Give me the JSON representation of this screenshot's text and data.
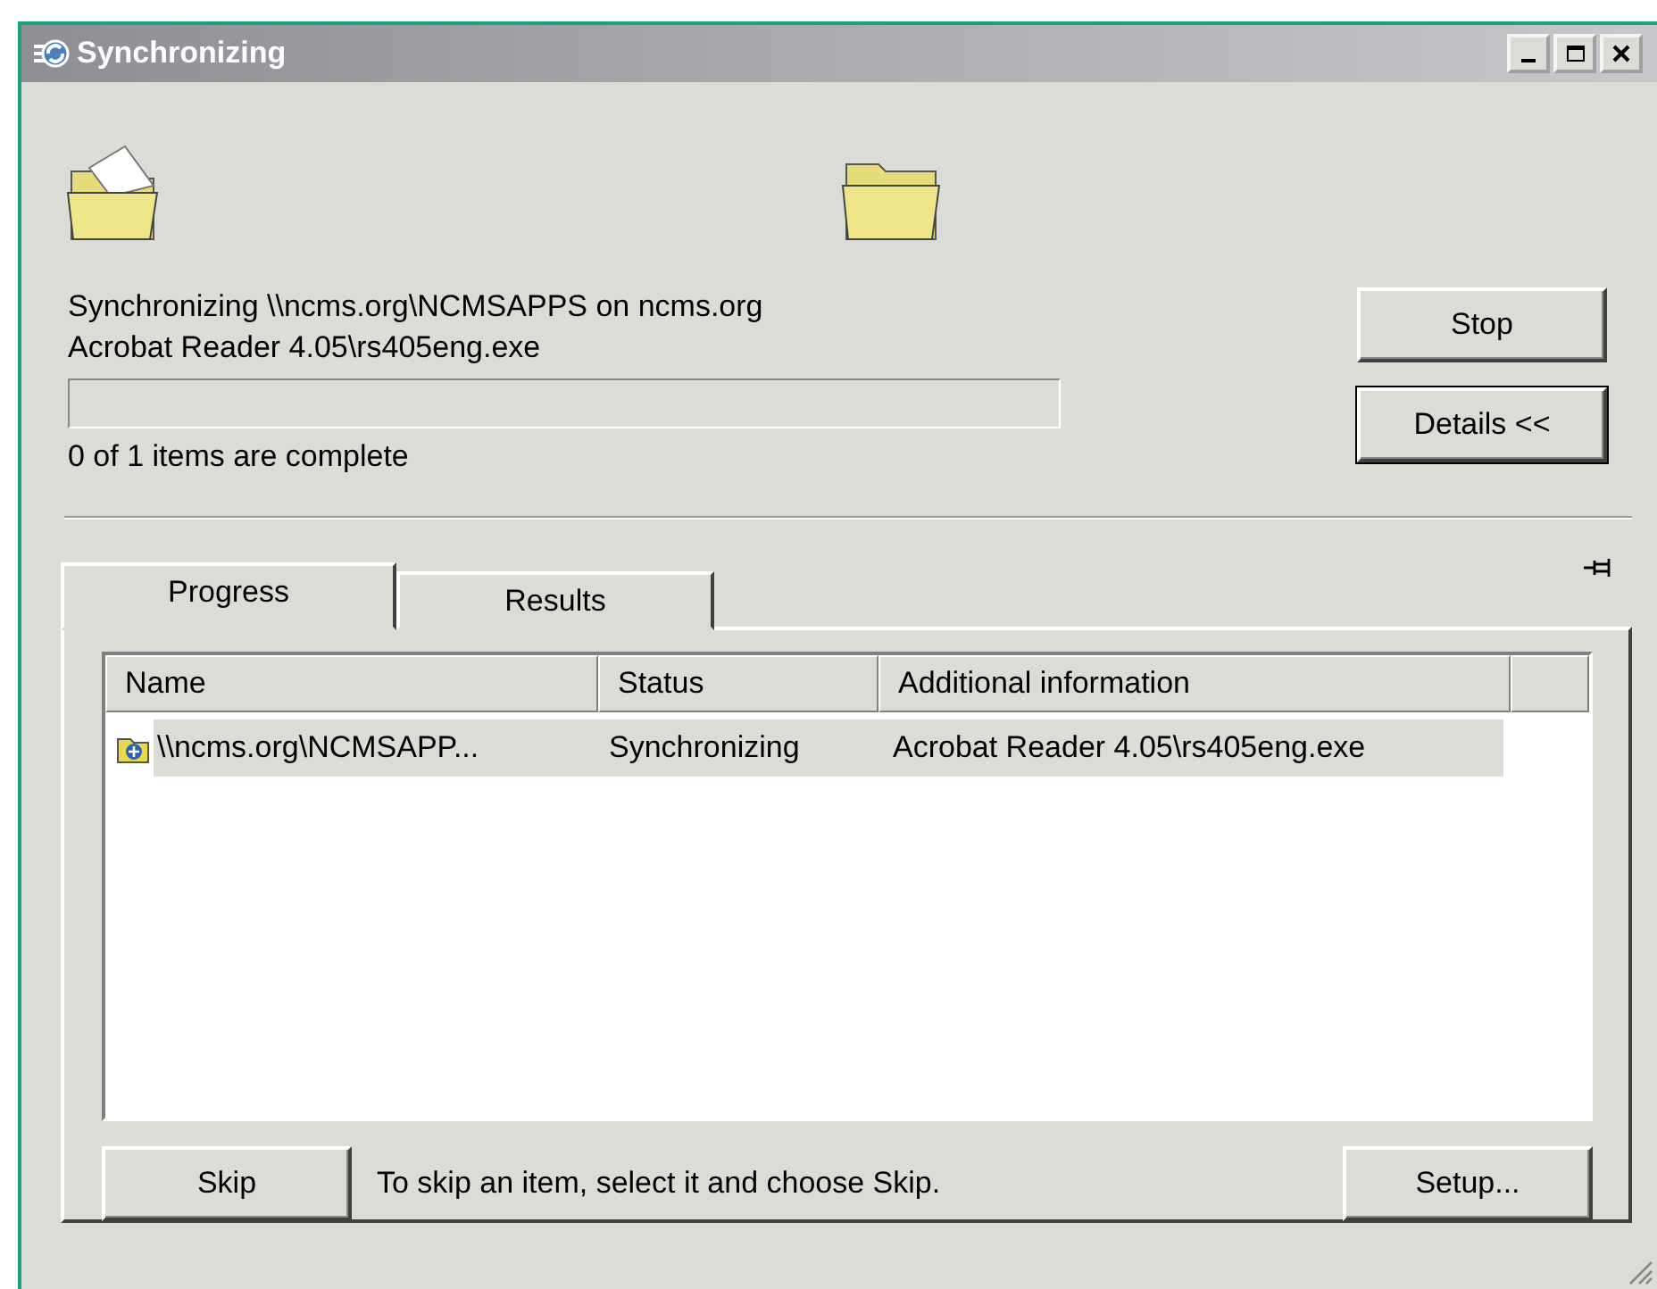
{
  "window": {
    "title": "Synchronizing"
  },
  "status_lines": [
    "Synchronizing \\\\ncms.org\\NCMSAPPS on ncms.org",
    "Acrobat Reader 4.05\\rs405eng.exe"
  ],
  "progress": {
    "level": 0,
    "caption": "0 of 1 items are complete"
  },
  "side_buttons": [
    "Stop",
    "Details <<"
  ],
  "tabs": [
    {
      "label": "Progress",
      "selected": true
    },
    {
      "label": "Results",
      "selected": false
    }
  ],
  "table": {
    "columns": [
      "Name",
      "Status",
      "Additional information"
    ],
    "rows": [
      {
        "cells": [
          "\\\\ncms.org\\NCMSAPP...",
          "Synchronizing",
          "Acrobat Reader 4.05\\rs405eng.exe"
        ],
        "selected": true
      }
    ]
  },
  "skip_button": "Skip",
  "hint": "To skip an item, select it and choose Skip.",
  "setup_button": "Setup..."
}
